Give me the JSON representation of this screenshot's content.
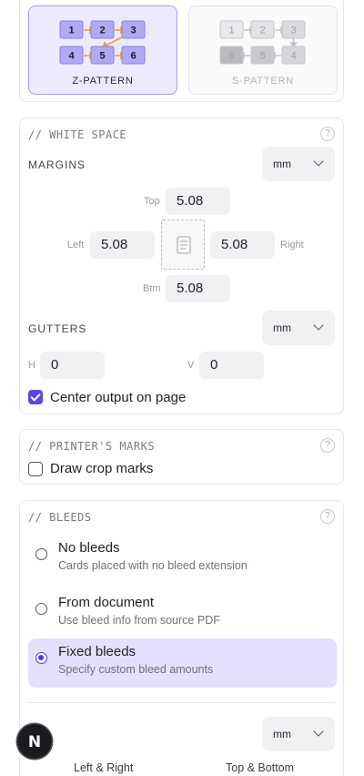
{
  "layout_pattern": {
    "z": {
      "label": "Z-PATTERN",
      "cells": [
        "1",
        "2",
        "3",
        "4",
        "5",
        "6"
      ],
      "selected": true
    },
    "s": {
      "label": "S-PATTERN",
      "cells": [
        "1",
        "2",
        "3",
        "6",
        "5",
        "4"
      ],
      "selected": false
    }
  },
  "white_space": {
    "title": "// WHITE SPACE",
    "help": "?",
    "margins": {
      "label": "MARGINS",
      "unit": "mm",
      "top_label": "Top",
      "top": "5.08",
      "left_label": "Left",
      "left": "5.08",
      "right_label": "Right",
      "right": "5.08",
      "bottom_label": "Btm",
      "bottom": "5.08"
    },
    "gutters": {
      "label": "GUTTERS",
      "unit": "mm",
      "h_label": "H",
      "h": "0",
      "v_label": "V",
      "v": "0"
    },
    "center_output": {
      "label": "Center output on page",
      "checked": true
    }
  },
  "printers_marks": {
    "title": "// PRINTER'S MARKS",
    "help": "?",
    "crop_marks": {
      "label": "Draw crop marks",
      "checked": false
    }
  },
  "bleeds": {
    "title": "// BLEEDS",
    "help": "?",
    "options": [
      {
        "title": "No bleeds",
        "desc": "Cards placed with no bleed extension",
        "selected": false
      },
      {
        "title": "From document",
        "desc": "Use bleed info from source PDF",
        "selected": false
      },
      {
        "title": "Fixed bleeds",
        "desc": "Specify custom bleed amounts",
        "selected": true
      }
    ],
    "unit": "mm",
    "left_right_label": "Left & Right",
    "top_bottom_label": "Top & Bottom"
  },
  "fab": {
    "letter": "N"
  },
  "colors": {
    "accent": "#5b48e0",
    "accent_bg": "#e3e0fd",
    "pattern_orange": "#f59a23"
  }
}
